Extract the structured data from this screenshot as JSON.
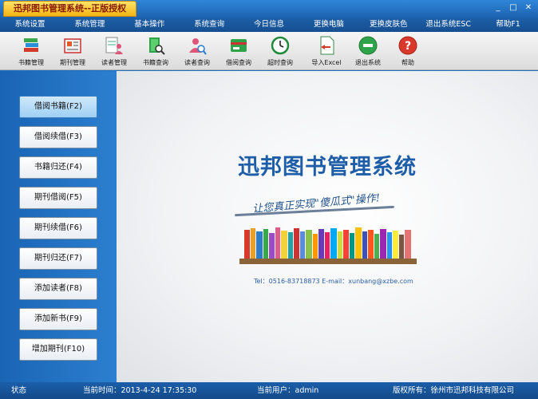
{
  "window": {
    "title": "迅邦图书管理系统--正版授权",
    "controls": [
      "_",
      "□",
      "✕"
    ]
  },
  "menu": [
    "系统设置",
    "系统管理",
    "基本操作",
    "系统查询",
    "今日信息",
    "更换电脑",
    "更换皮肤色",
    "退出系统ESC",
    "帮助F1"
  ],
  "toolbar": [
    {
      "label": "书籍管理",
      "icon": "book-stack-icon"
    },
    {
      "label": "期刊管理",
      "icon": "magazine-icon"
    },
    {
      "label": "读者管理",
      "icon": "reader-icon"
    },
    {
      "label": "书籍查询",
      "icon": "book-search-icon"
    },
    {
      "label": "读者查询",
      "icon": "reader-search-icon"
    },
    {
      "label": "借阅查询",
      "icon": "borrow-search-icon"
    },
    {
      "label": "超时查询",
      "icon": "clock-icon"
    },
    {
      "label": "导入Excel",
      "icon": "import-excel-icon"
    },
    {
      "label": "退出系统",
      "icon": "exit-icon"
    },
    {
      "label": "帮助",
      "icon": "help-icon"
    }
  ],
  "sidebar": [
    {
      "label": "借阅书籍(F2)",
      "active": true
    },
    {
      "label": "借阅续借(F3)",
      "active": false
    },
    {
      "label": "书籍归还(F4)",
      "active": false
    },
    {
      "label": "期刊借阅(F5)",
      "active": false
    },
    {
      "label": "期刊续借(F6)",
      "active": false
    },
    {
      "label": "期刊归还(F7)",
      "active": false
    },
    {
      "label": "添加读者(F8)",
      "active": false
    },
    {
      "label": "添加新书(F9)",
      "active": false
    },
    {
      "label": "增加期刊(F10)",
      "active": false
    }
  ],
  "main": {
    "title": "迅邦图书管理系统",
    "slogan": "让您真正实现\"傻瓜式\"操作!",
    "contact": "Tel：0516-83718873   E-mail：xunbang@xzbe.com"
  },
  "status": {
    "label": "状态",
    "time": "当前时间：2013-4-24  17:35:30",
    "user": "当前用户：admin",
    "copyright": "版权所有：徐州市迅邦科技有限公司"
  },
  "colors": {
    "accent": "#1e5ea8",
    "titleTab": "#f2b413",
    "sidebar": "#1a64b4"
  }
}
